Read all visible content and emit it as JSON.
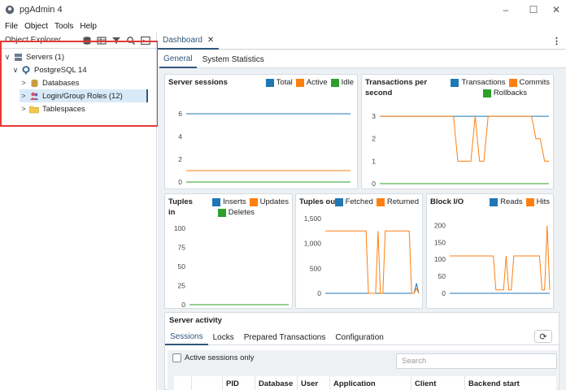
{
  "window": {
    "title": "pgAdmin 4",
    "controls": [
      "–",
      "☐",
      "✕"
    ]
  },
  "menu": [
    "File",
    "Object",
    "Tools",
    "Help"
  ],
  "explorer": {
    "title": "Object Explorer",
    "tree": [
      {
        "label": "Servers (1)",
        "chevron": "∨"
      },
      {
        "label": "PostgreSQL 14",
        "chevron": "∨"
      },
      {
        "label": "Databases",
        "chevron": ">"
      },
      {
        "label": "Login/Group Roles (12)",
        "chevron": ">"
      },
      {
        "label": "Tablespaces",
        "chevron": ">"
      }
    ]
  },
  "tabs": {
    "dashboard_label": "Dashboard",
    "close_glyph": "✕",
    "more_glyph": "⋮"
  },
  "subtabs": [
    "General",
    "System Statistics"
  ],
  "colors": {
    "blue": "#1f77b4",
    "orange": "#ff7f0e",
    "green": "#2ca02c",
    "accent": "#31577b",
    "highlight": "#e53935"
  },
  "panels": {
    "server_sessions": {
      "title": "Server sessions",
      "legend": [
        "Total",
        "Active",
        "Idle"
      ]
    },
    "transactions": {
      "title": "Transactions per second",
      "legend": [
        "Transactions",
        "Commits",
        "Rollbacks"
      ]
    },
    "tuples_in": {
      "title": "Tuples in",
      "legend": [
        "Inserts",
        "Updates",
        "Deletes"
      ]
    },
    "tuples_out": {
      "title": "Tuples out",
      "legend": [
        "Fetched",
        "Returned"
      ]
    },
    "block_io": {
      "title": "Block I/O",
      "legend": [
        "Reads",
        "Hits"
      ]
    }
  },
  "chart_data": [
    {
      "type": "line",
      "title": "Server sessions",
      "ylim": [
        0,
        7
      ],
      "yticks": [
        "0",
        "2",
        "4",
        "6"
      ],
      "series": [
        {
          "name": "Total",
          "values": [
            6,
            6,
            6,
            6,
            6,
            6,
            6,
            6,
            6,
            6
          ]
        },
        {
          "name": "Active",
          "values": [
            1,
            1,
            1,
            1,
            1,
            1,
            1,
            1,
            1,
            1
          ]
        },
        {
          "name": "Idle",
          "values": [
            0,
            0,
            0,
            0,
            0,
            0,
            0,
            0,
            0,
            0
          ]
        }
      ]
    },
    {
      "type": "line",
      "title": "Transactions per second",
      "ylim": [
        0,
        3.4
      ],
      "yticks": [
        "0",
        "1",
        "2",
        "3"
      ],
      "series": [
        {
          "name": "Transactions",
          "values": [
            3,
            3,
            3,
            3,
            3,
            3,
            3,
            3,
            3,
            3,
            3,
            3,
            3,
            3,
            3,
            3,
            3,
            3,
            3,
            3,
            3,
            3,
            3,
            3,
            3,
            3,
            3,
            3,
            3,
            3,
            3,
            3,
            3,
            3,
            3,
            3,
            3,
            3,
            3,
            3
          ]
        },
        {
          "name": "Commits",
          "values": [
            3,
            3,
            3,
            3,
            3,
            3,
            3,
            3,
            3,
            3,
            3,
            3,
            3,
            3,
            3,
            3,
            3,
            3,
            1,
            1,
            1,
            1,
            3,
            1,
            1,
            3,
            3,
            3,
            3,
            3,
            3,
            3,
            3,
            3,
            3,
            3,
            2,
            2,
            1,
            1
          ]
        },
        {
          "name": "Rollbacks",
          "values": [
            0,
            0,
            0,
            0,
            0,
            0,
            0,
            0,
            0,
            0,
            0,
            0,
            0,
            0,
            0,
            0,
            0,
            0,
            0,
            0,
            0,
            0,
            0,
            0,
            0,
            0,
            0,
            0,
            0,
            0,
            0,
            0,
            0,
            0,
            0,
            0,
            0,
            0,
            0,
            0
          ]
        }
      ]
    },
    {
      "type": "line",
      "title": "Tuples in",
      "ylim": [
        0,
        100
      ],
      "yticks": [
        "0",
        "25",
        "50",
        "75",
        "100"
      ],
      "series": [
        {
          "name": "Inserts",
          "values": [
            0,
            0,
            0,
            0,
            0,
            0,
            0,
            0,
            0,
            0
          ]
        },
        {
          "name": "Updates",
          "values": [
            0,
            0,
            0,
            0,
            0,
            0,
            0,
            0,
            0,
            0
          ]
        },
        {
          "name": "Deletes",
          "values": [
            0,
            0,
            0,
            0,
            0,
            0,
            0,
            0,
            0,
            0
          ]
        }
      ]
    },
    {
      "type": "line",
      "title": "Tuples out",
      "ylim": [
        0,
        1500
      ],
      "yticks": [
        "0",
        "500",
        "1,000",
        "1,500"
      ],
      "series": [
        {
          "name": "Fetched",
          "values": [
            0,
            0,
            0,
            0,
            0,
            0,
            0,
            0,
            0,
            0,
            0,
            0,
            0,
            0,
            0,
            0,
            0,
            0,
            0,
            0,
            0,
            0,
            0,
            0,
            0,
            0,
            0,
            0,
            0,
            0,
            0,
            0,
            0,
            0,
            0,
            0,
            0,
            0,
            200,
            0
          ]
        },
        {
          "name": "Returned",
          "values": [
            1250,
            1250,
            1250,
            1250,
            1250,
            1250,
            1250,
            1250,
            1250,
            1250,
            1250,
            1250,
            1250,
            1250,
            1250,
            1250,
            1250,
            1250,
            0,
            0,
            0,
            0,
            1250,
            0,
            0,
            1250,
            1250,
            1250,
            1250,
            1250,
            1250,
            1250,
            1250,
            1250,
            1250,
            1250,
            0,
            0,
            100,
            0
          ]
        }
      ]
    },
    {
      "type": "line",
      "title": "Block I/O",
      "ylim": [
        0,
        220
      ],
      "yticks": [
        "0",
        "50",
        "100",
        "150",
        "200"
      ],
      "series": [
        {
          "name": "Reads",
          "values": [
            0,
            0,
            0,
            0,
            0,
            0,
            0,
            0,
            0,
            0,
            0,
            0,
            0,
            0,
            0,
            0,
            0,
            0,
            0,
            0,
            0,
            0,
            0,
            0,
            0,
            0,
            0,
            0,
            0,
            0,
            0,
            0,
            0,
            0,
            0,
            0,
            0,
            0,
            0,
            0
          ]
        },
        {
          "name": "Hits",
          "values": [
            110,
            110,
            110,
            110,
            110,
            110,
            110,
            110,
            110,
            110,
            110,
            110,
            110,
            110,
            110,
            110,
            110,
            110,
            10,
            10,
            10,
            10,
            110,
            10,
            10,
            110,
            110,
            110,
            110,
            110,
            110,
            110,
            110,
            110,
            110,
            110,
            10,
            10,
            200,
            10
          ]
        }
      ]
    }
  ],
  "activity": {
    "title": "Server activity",
    "tabs": [
      "Sessions",
      "Locks",
      "Prepared Transactions",
      "Configuration"
    ],
    "refresh_glyph": "⟳",
    "active_only_label": "Active sessions only",
    "search_placeholder": "Search",
    "columns": [
      "",
      "",
      "PID",
      "Database",
      "User",
      "Application",
      "Client",
      "Backend start"
    ]
  }
}
